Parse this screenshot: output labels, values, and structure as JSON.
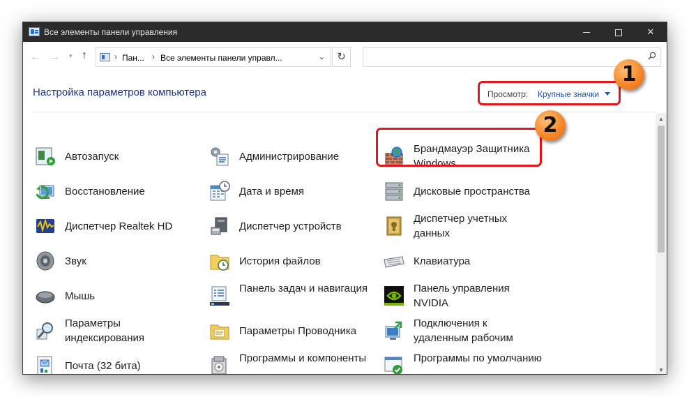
{
  "window": {
    "title": "Все элементы панели управления",
    "minimize_glyph": "",
    "maximize_glyph": "",
    "close_glyph": "✕"
  },
  "nav": {
    "back_glyph": "←",
    "forward_glyph": "→",
    "recent_glyph": "▾",
    "up_glyph": "↑",
    "breadcrumb_separator": "›",
    "breadcrumb": [
      "Пан...",
      "Все элементы панели управл..."
    ],
    "address_dropdown_glyph": "⌄",
    "refresh_glyph": "↻",
    "search_placeholder": ""
  },
  "header": {
    "title": "Настройка параметров компьютера",
    "view_label": "Просмотр:",
    "view_value": "Крупные значки"
  },
  "items": [
    {
      "label": "Автозапуск",
      "icon": "autoplay-icon"
    },
    {
      "label": "Администрирование",
      "icon": "administrative-tools-icon"
    },
    {
      "label": "Брандмауэр Защитника Windows",
      "icon": "firewall-icon"
    },
    {
      "label": "Восстановление",
      "icon": "recovery-icon"
    },
    {
      "label": "Дата и время",
      "icon": "date-time-icon"
    },
    {
      "label": "Дисковые пространства",
      "icon": "storage-spaces-icon"
    },
    {
      "label": "Диспетчер Realtek HD",
      "icon": "realtek-audio-icon"
    },
    {
      "label": "Диспетчер устройств",
      "icon": "device-manager-icon"
    },
    {
      "label": "Диспетчер учетных данных",
      "icon": "credential-manager-icon"
    },
    {
      "label": "Звук",
      "icon": "sound-icon"
    },
    {
      "label": "История файлов",
      "icon": "file-history-icon"
    },
    {
      "label": "Клавиатура",
      "icon": "keyboard-icon"
    },
    {
      "label": "Мышь",
      "icon": "mouse-icon"
    },
    {
      "label": "Панель задач и навигация",
      "icon": "taskbar-icon"
    },
    {
      "label": "Панель управления NVIDIA",
      "icon": "nvidia-icon"
    },
    {
      "label": "Параметры индексирования",
      "icon": "indexing-icon"
    },
    {
      "label": "Параметры Проводника",
      "icon": "explorer-options-icon"
    },
    {
      "label": "Подключения к удаленным рабочим",
      "icon": "remote-connections-icon"
    },
    {
      "label": "Почта (32 бита)",
      "icon": "mail-icon"
    },
    {
      "label": "Программы и компоненты",
      "icon": "programs-features-icon"
    },
    {
      "label": "Программы по умолчанию",
      "icon": "default-programs-icon"
    }
  ],
  "annotations": {
    "badge_1": "1",
    "badge_2": "2",
    "marker_color": "#e1161a",
    "badge_color": "#f7892a"
  },
  "colors": {
    "titlebar": "#2b2b2b",
    "heading": "#1e3287",
    "link": "#1e55b6"
  }
}
